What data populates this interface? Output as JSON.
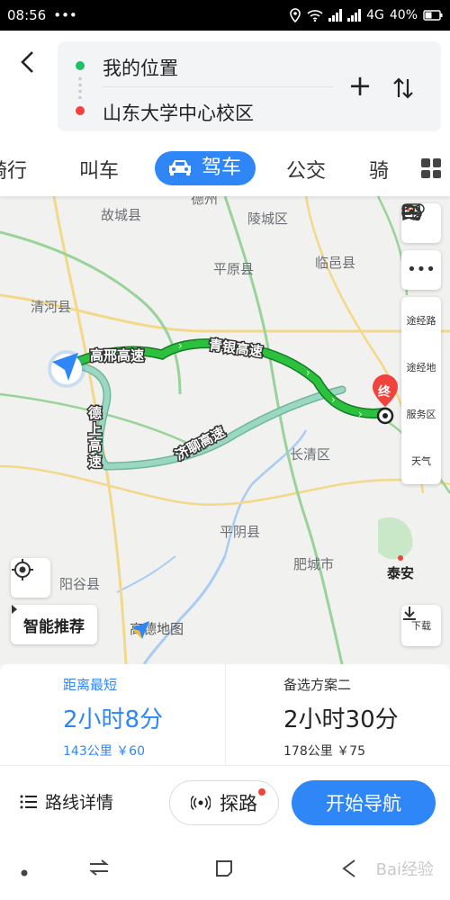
{
  "status_bar": {
    "time": "08:56",
    "more": "•••",
    "network": "4G",
    "battery": "40%"
  },
  "header": {
    "from": "我的位置",
    "to": "山东大学中心校区"
  },
  "tabs": [
    {
      "label": "骑行"
    },
    {
      "label": "叫车"
    },
    {
      "label": "驾车"
    },
    {
      "label": "公交"
    },
    {
      "label": "骑"
    }
  ],
  "map": {
    "places": [
      "故城县",
      "陵城区",
      "平原县",
      "临邑县",
      "清河县",
      "长清区",
      "平阴县",
      "肥城市",
      "阳谷县",
      "泰安",
      "德州"
    ],
    "roads": [
      "高邢高速",
      "青银高速",
      "济聊高速",
      "德上高速"
    ],
    "end_marker": "终",
    "tools": {
      "waypoint_route": "途经路",
      "waypoint_place": "途经地",
      "service_area": "服务区",
      "weather": "天气",
      "download": "下载"
    },
    "smart_recommend": "智能推荐",
    "brand": "高德地图"
  },
  "routes": [
    {
      "label": "距离最短",
      "time": "2小时8分",
      "meta": "143公里 ￥60"
    },
    {
      "label": "备选方案二",
      "time": "2小时30分",
      "meta": "178公里 ￥75"
    }
  ],
  "actions": {
    "details": "路线详情",
    "explore": "探路",
    "start": "开始导航"
  },
  "watermark": "Bai经验",
  "colors": {
    "accent": "#2f86f6",
    "route_main": "#1fbb3b",
    "route_alt": "#7dcab0"
  }
}
